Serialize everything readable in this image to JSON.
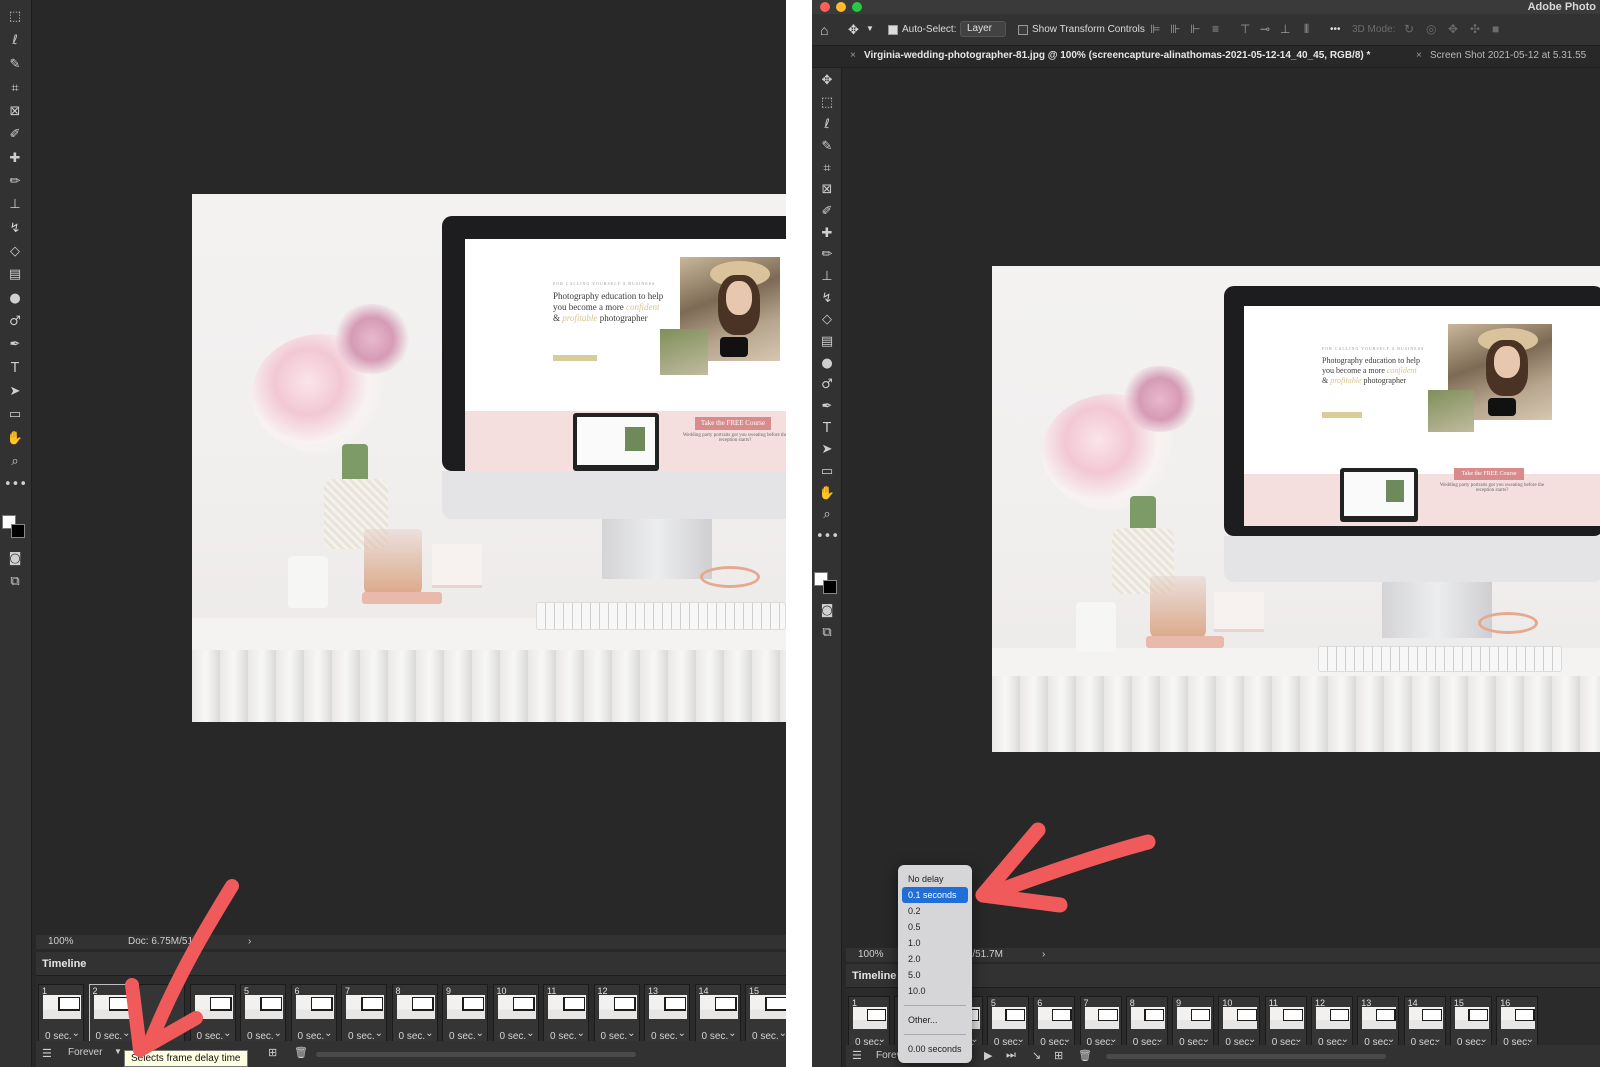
{
  "left": {
    "status": {
      "zoom": "100%",
      "doc": "Doc: 6.75M/51",
      "expand": "›"
    },
    "timeline": {
      "title": "Timeline",
      "frames": [
        {
          "num": "1",
          "delay": "0 sec."
        },
        {
          "num": "2",
          "delay": "0 sec."
        },
        {
          "num": "",
          "delay": ""
        },
        {
          "num": "",
          "delay": "0 sec."
        },
        {
          "num": "5",
          "delay": "0 sec."
        },
        {
          "num": "6",
          "delay": "0 sec."
        },
        {
          "num": "7",
          "delay": "0 sec."
        },
        {
          "num": "8",
          "delay": "0 sec."
        },
        {
          "num": "9",
          "delay": "0 sec."
        },
        {
          "num": "10",
          "delay": "0 sec."
        },
        {
          "num": "11",
          "delay": "0 sec."
        },
        {
          "num": "12",
          "delay": "0 sec."
        },
        {
          "num": "13",
          "delay": "0 sec."
        },
        {
          "num": "14",
          "delay": "0 sec."
        },
        {
          "num": "15",
          "delay": "0 sec."
        }
      ],
      "loop": "Forever",
      "tooltip": "Selects frame delay time"
    }
  },
  "right": {
    "app_title": "Adobe Photo",
    "options": {
      "auto_select_label": "Auto-Select:",
      "auto_select_value": "Layer",
      "transform_label": "Show Transform Controls",
      "more": "•••",
      "mode_3d": "3D Mode:"
    },
    "tabs": [
      {
        "label": "Virginia-wedding-photographer-81.jpg @ 100% (screencapture-alinathomas-2021-05-12-14_40_45, RGB/8) *",
        "close": "×"
      },
      {
        "label": "Screen Shot 2021-05-12 at 5.31.55",
        "close": "×"
      }
    ],
    "status": {
      "zoom": "100%",
      "doc": "M/51.7M",
      "expand": "›"
    },
    "timeline": {
      "title": "Timeline",
      "frames": [
        {
          "num": "1",
          "delay": "0 sec."
        },
        {
          "num": "",
          "delay": ""
        },
        {
          "num": "4",
          "delay": "0 sec."
        },
        {
          "num": "5",
          "delay": "0 sec."
        },
        {
          "num": "6",
          "delay": "0 sec."
        },
        {
          "num": "7",
          "delay": "0 sec."
        },
        {
          "num": "8",
          "delay": "0 sec."
        },
        {
          "num": "9",
          "delay": "0 sec."
        },
        {
          "num": "10",
          "delay": "0 sec."
        },
        {
          "num": "11",
          "delay": "0 sec."
        },
        {
          "num": "12",
          "delay": "0 sec."
        },
        {
          "num": "13",
          "delay": "0 sec."
        },
        {
          "num": "14",
          "delay": "0 sec."
        },
        {
          "num": "15",
          "delay": "0 sec."
        },
        {
          "num": "16",
          "delay": "0 sec."
        }
      ],
      "loop": "Forever"
    },
    "delay_menu": {
      "items": [
        "No delay",
        "0.1 seconds",
        "0.2",
        "0.5",
        "1.0",
        "2.0",
        "5.0",
        "10.0"
      ],
      "selected": "0.1 seconds",
      "other": "Other...",
      "current": "0.00 seconds"
    }
  },
  "website": {
    "eyebrow": "FOR CALLING YOURSELF A BUSINESS",
    "heading_line1": "Photography education to help",
    "heading_line2": "you become a more",
    "script1": "confident",
    "heading_line3_prefix": "&",
    "script2": "profitable",
    "heading_line3": "photographer",
    "cta": "Take the FREE Course",
    "promo": "Wedding party portraits got you sweating before the reception starts?"
  },
  "colors": {
    "accent_red": "#f05a5b",
    "selected_blue": "#1f6fd6",
    "tooltip_bg": "#ffffe1",
    "pink_band": "#f4dede"
  }
}
